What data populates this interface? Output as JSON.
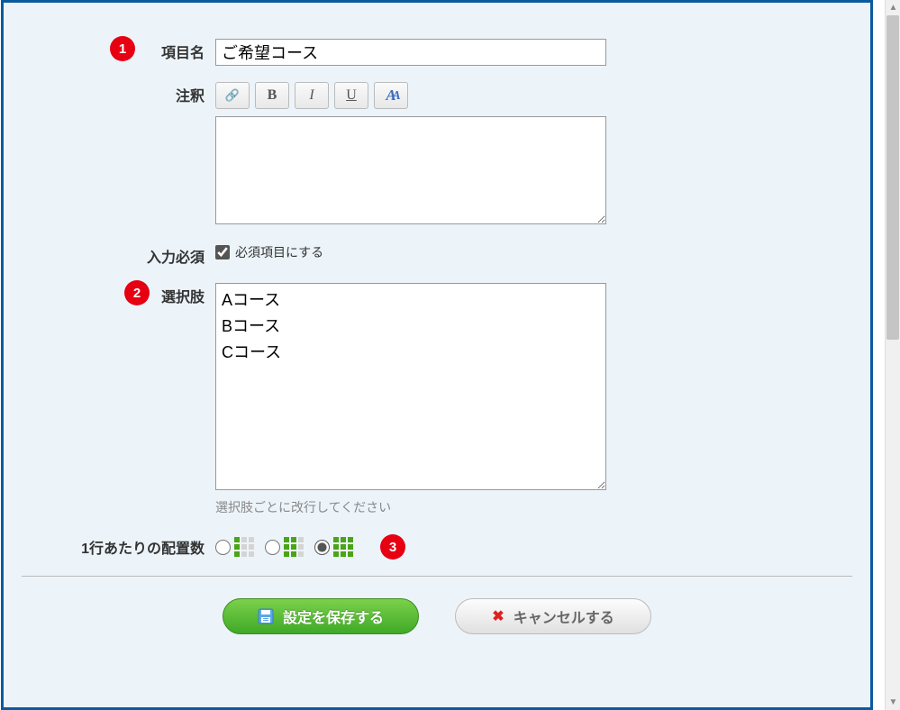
{
  "badges": {
    "one": "1",
    "two": "2",
    "three": "3"
  },
  "labels": {
    "item_name": "項目名",
    "annotation": "注釈",
    "required": "入力必須",
    "choices": "選択肢",
    "layout_count": "1行あたりの配置数"
  },
  "fields": {
    "item_name_value": "ご希望コース",
    "annotation_value": "",
    "required_checkbox_label": "必須項目にする",
    "required_checked": true,
    "choices_value": "Aコース\nBコース\nCコース",
    "choices_hint": "選択肢ごとに改行してください"
  },
  "toolbar": {
    "link": "⛓",
    "bold": "B",
    "italic": "I",
    "underline": "U",
    "font": "A"
  },
  "layout": {
    "selected": 3,
    "options": [
      1,
      2,
      3
    ]
  },
  "buttons": {
    "save": "設定を保存する",
    "cancel": "キャンセルする"
  }
}
